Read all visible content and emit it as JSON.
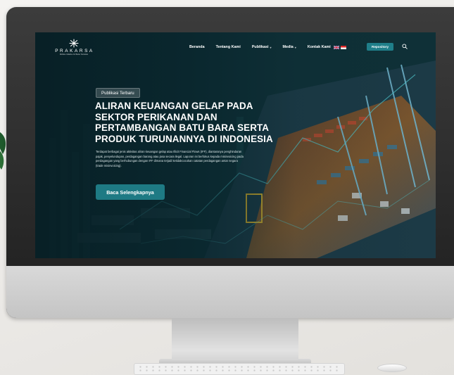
{
  "nav": {
    "logo_text": "PRAKARSA",
    "logo_tagline": "Welfare Initiative for Better Societies",
    "items": [
      {
        "label": "Beranda",
        "has_dropdown": false
      },
      {
        "label": "Tentang Kami",
        "has_dropdown": false
      },
      {
        "label": "Publikasi",
        "has_dropdown": true
      },
      {
        "label": "Media",
        "has_dropdown": true
      },
      {
        "label": "Kontak Kami",
        "has_dropdown": false
      }
    ],
    "repository_label": "Repository",
    "icons": {
      "search": "search-icon",
      "flags": [
        "uk-flag-icon",
        "indonesia-flag-icon"
      ]
    }
  },
  "hero": {
    "badge": "Publikasi Terbaru",
    "title": "ALIRAN KEUANGAN GELAP PADA SEKTOR PERIKANAN DAN PERTAMBANGAN BATU BARA SERTA PRODUK TURUNANNYA DI INDONESIA",
    "description": "Terdapat berbagai jenis aktivitas aliran keuangan gelap atau Illicit Financial Flows (IFF), diantaranya penghindaran pajak, penyelundupan, perdagangan barang atau jasa secara ilegal. Laporan ini berfokus kepada misinvoicing pada perdagangan yang berhubungan dengan IFF dimana terjadi ketidakcocokan catatan perdagangan antar negara (trade misinvoicing).",
    "cta_label": "Baca Selengkapnya"
  },
  "colors": {
    "accent": "#1e7a84",
    "hero_bg": "#0c2a30",
    "monitor_bezel": "#2a2a2a"
  }
}
